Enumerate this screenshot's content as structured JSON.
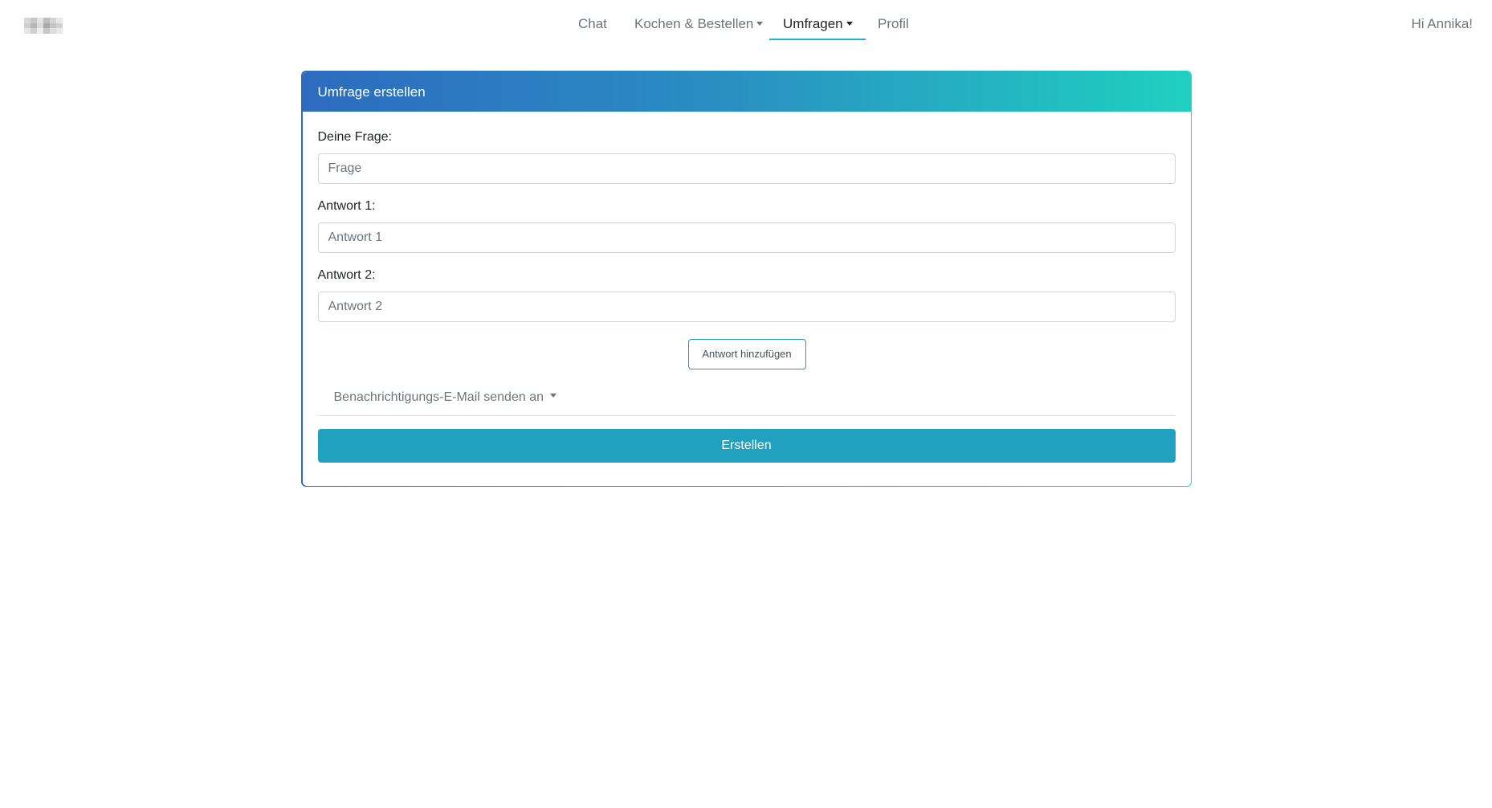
{
  "nav": {
    "items": [
      {
        "label": "Chat",
        "has_dropdown": false,
        "active": false
      },
      {
        "label": "Kochen & Bestellen",
        "has_dropdown": true,
        "active": false
      },
      {
        "label": "Umfragen",
        "has_dropdown": true,
        "active": true
      },
      {
        "label": "Profil",
        "has_dropdown": false,
        "active": false
      }
    ],
    "greeting": "Hi Annika!"
  },
  "card": {
    "title": "Umfrage erstellen",
    "question": {
      "label": "Deine Frage:",
      "placeholder": "Frage",
      "value": ""
    },
    "answers": [
      {
        "label": "Antwort 1:",
        "placeholder": "Antwort 1",
        "value": ""
      },
      {
        "label": "Antwort 2:",
        "placeholder": "Antwort 2",
        "value": ""
      }
    ],
    "add_answer_label": "Antwort hinzufügen",
    "notify_label": "Benachrichtigungs-E-Mail senden an",
    "submit_label": "Erstellen"
  },
  "colors": {
    "header_gradient_start": "#2d6bbf",
    "header_gradient_end": "#1fd0c0",
    "submit_button": "#21a0bf",
    "active_underline": "#1fb3c8"
  },
  "icons": {
    "brand": "blurred-logo-icon",
    "dropdown": "caret-down-icon"
  }
}
